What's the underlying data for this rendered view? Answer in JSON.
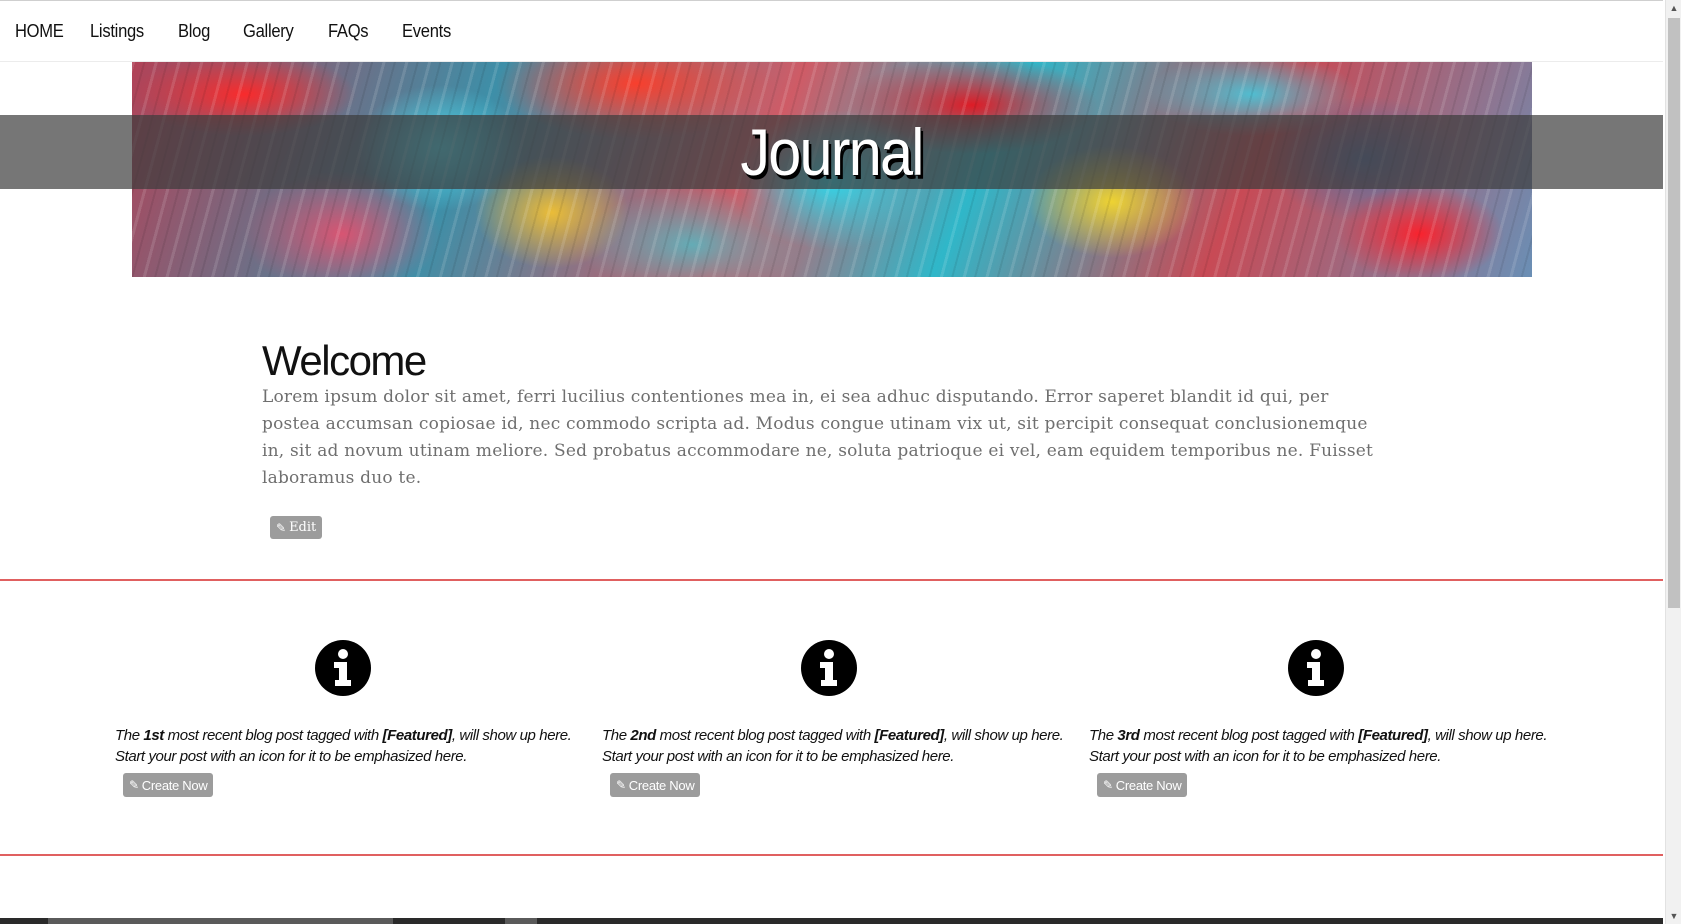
{
  "nav": {
    "items": [
      "HOME",
      "Listings",
      "Blog",
      "Gallery",
      "FAQs",
      "Events"
    ]
  },
  "hero": {
    "title": "Journal"
  },
  "welcome": {
    "title": "Welcome",
    "body": "Lorem ipsum dolor sit amet, ferri lucilius contentiones mea in, ei sea adhuc disputando. Error saperet blandit id qui, per postea accumsan copiosae id, nec commodo scripta ad. Modus congue utinam vix ut, sit percipit consequat conclusionemque in, sit ad novum utinam meliore. Sed probatus accommodare ne, soluta patrioque ei vel, eam equidem temporibus ne. Fuisset laboramus duo te.",
    "edit_label": "Edit"
  },
  "features": [
    {
      "prefix": "The ",
      "ordinal": "1st",
      "middle": " most recent blog post tagged with ",
      "tag": "[Featured]",
      "suffix": ", will show up here.",
      "line2": "Start your post with an icon for it to be emphasized here.",
      "button": "Create Now"
    },
    {
      "prefix": "The ",
      "ordinal": "2nd",
      "middle": " most recent blog post tagged with ",
      "tag": "[Featured]",
      "suffix": ", will show up here.",
      "line2": "Start your post with an icon for it to be emphasized here.",
      "button": "Create Now"
    },
    {
      "prefix": "The ",
      "ordinal": "3rd",
      "middle": " most recent blog post tagged with ",
      "tag": "[Featured]",
      "suffix": ", will show up here.",
      "line2": "Start your post with an icon for it to be emphasized here.",
      "button": "Create Now"
    }
  ],
  "colors": {
    "divider": "#e06060",
    "button": "#9c9c9c"
  },
  "icons": {
    "feature": "info-circle-icon",
    "edit": "pencil-icon"
  }
}
